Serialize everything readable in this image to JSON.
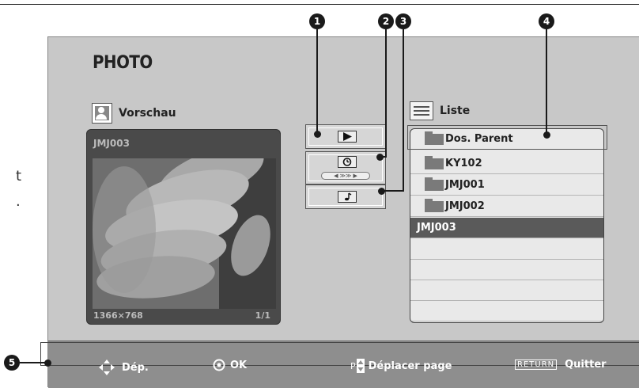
{
  "title": "PHOTO",
  "stray_text": [
    "t",
    "."
  ],
  "preview": {
    "header": "Vorschau",
    "filename": "JMJ003",
    "resolution": "1366×768",
    "page": "1/1"
  },
  "list": {
    "header": "Liste",
    "items": [
      {
        "label": "Dos. Parent",
        "icon": "parent-folder-icon",
        "selected": false
      },
      {
        "label": "KY102",
        "icon": "folder-icon",
        "selected": false
      },
      {
        "label": "JMJ001",
        "icon": "folder-icon",
        "selected": false
      },
      {
        "label": "JMJ002",
        "icon": "folder-icon",
        "selected": false
      },
      {
        "label": "JMJ003",
        "icon": "",
        "selected": true
      }
    ]
  },
  "controls": {
    "play_icon": "play-icon",
    "timer_icon": "timer-icon",
    "music_icon": "music-icon",
    "speed_label": "◀ ≫≫ ▶"
  },
  "callouts": [
    "1",
    "2",
    "3",
    "4",
    "5"
  ],
  "bottom_bar": {
    "move": "Dép.",
    "ok": "OK",
    "page_prefix": "P",
    "page": "Déplacer page",
    "return_key": "RETURN",
    "quit": "Quitter"
  },
  "colors": {
    "screen_bg": "#c8c8c8",
    "bar_bg": "#8e8e8e",
    "selected_row": "#5a5a5a"
  }
}
